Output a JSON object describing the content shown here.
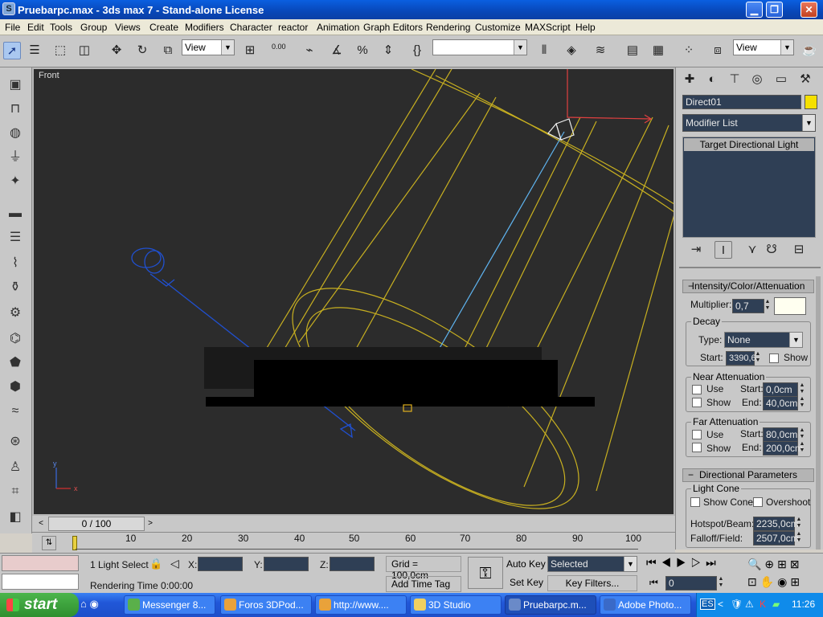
{
  "window": {
    "title": "Pruebarpc.max - 3ds max 7 - Stand-alone License",
    "app_icon": "S"
  },
  "menu": [
    "File",
    "Edit",
    "Tools",
    "Group",
    "Views",
    "Create",
    "Modifiers",
    "Character",
    "reactor",
    "Animation",
    "Graph Editors",
    "Rendering",
    "Customize",
    "MAXScript",
    "Help"
  ],
  "toolbar": {
    "ref_coord": "View",
    "spinner_snap": "0.00",
    "named_selection": "",
    "view2": "View"
  },
  "viewport": {
    "label": "Front",
    "axes": {
      "x": "x",
      "y": "y"
    }
  },
  "command_panel": {
    "object_name": "Direct01",
    "object_color": "#f5e000",
    "modifier_list": "Modifier List",
    "stack_item": "Target Directional Light",
    "rollouts": {
      "intensity": {
        "title": "Intensity/Color/Attenuation",
        "multiplier_label": "Multiplier:",
        "multiplier": "0,7",
        "color": "#fffff0",
        "decay_title": "Decay",
        "type_label": "Type:",
        "type": "None",
        "start_label": "Start:",
        "start": "3390,6",
        "show_label": "Show",
        "near_title": "Near Attenuation",
        "use_label": "Use",
        "near_start": "0,0cm",
        "near_end": "40,0cm",
        "end_label": "End:",
        "far_title": "Far Attenuation",
        "far_start": "80,0cm",
        "far_end": "200,0cm"
      },
      "directional": {
        "title": "Directional Parameters",
        "cone_title": "Light Cone",
        "show_cone": "Show Cone",
        "overshoot": "Overshoot",
        "hotspot_label": "Hotspot/Beam:",
        "hotspot": "2235,0cm",
        "falloff_label": "Falloff/Field:",
        "falloff": "2507,0cm"
      }
    }
  },
  "timeline": {
    "position": "0 / 100",
    "ticks": [
      "10",
      "20",
      "30",
      "40",
      "50",
      "60",
      "70",
      "80",
      "90",
      "100"
    ]
  },
  "status": {
    "selection": "1 Light Select",
    "x_label": "X:",
    "y_label": "Y:",
    "z_label": "Z:",
    "grid": "Grid = 100,0cm",
    "rendering_time": "Rendering Time  0:00:00",
    "add_time_tag": "Add Time Tag",
    "auto_key": "Auto Key",
    "set_key": "Set Key",
    "key_mode": "Selected",
    "key_filters": "Key Filters...",
    "frame": "0"
  },
  "taskbar": {
    "start": "start",
    "tasks": [
      "Messenger 8...",
      "Foros 3DPod...",
      "http://www....",
      "3D Studio",
      "Pruebarpc.m...",
      "Adobe Photo..."
    ],
    "lang": "ES",
    "clock": "11:26"
  }
}
